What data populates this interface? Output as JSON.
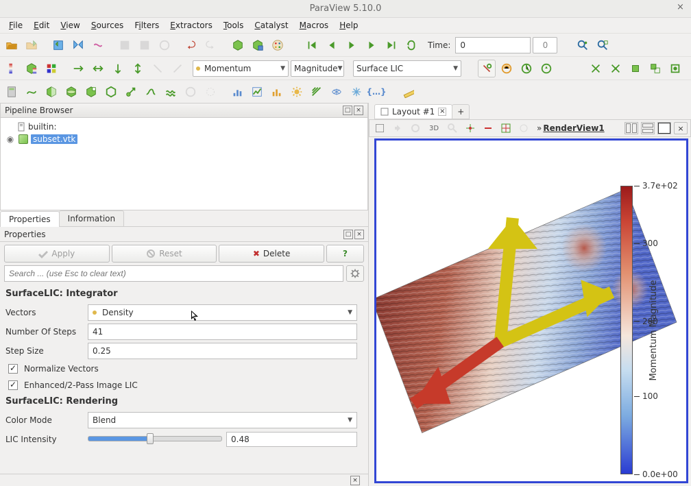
{
  "window": {
    "title": "ParaView 5.10.0",
    "close": "×"
  },
  "menu": [
    "File",
    "Edit",
    "View",
    "Sources",
    "Filters",
    "Extractors",
    "Tools",
    "Catalyst",
    "Macros",
    "Help"
  ],
  "toolbar1": {
    "time_label": "Time:",
    "time_value": "0",
    "frame_value": "0"
  },
  "toolbar2": {
    "combo_array": "Momentum",
    "combo_component": "Magnitude",
    "combo_representation": "Surface LIC"
  },
  "pipeline": {
    "title": "Pipeline Browser",
    "root": "builtin:",
    "item": "subset.vtk"
  },
  "tabs": {
    "properties": "Properties",
    "information": "Information"
  },
  "properties": {
    "head": "Properties",
    "apply": "Apply",
    "reset": "Reset",
    "delete": "Delete",
    "search_placeholder": "Search ... (use Esc to clear text)",
    "section_integrator": "SurfaceLIC: Integrator",
    "vectors_label": "Vectors",
    "vectors_value": "Density",
    "steps_label": "Number Of Steps",
    "steps_value": "41",
    "stepsize_label": "Step Size",
    "stepsize_value": "0.25",
    "normalize": "Normalize Vectors",
    "twopass": "Enhanced/2-Pass Image LIC",
    "section_rendering": "SurfaceLIC: Rendering",
    "colormode_label": "Color Mode",
    "colormode_value": "Blend",
    "licintensity_label": "LIC Intensity",
    "licintensity_value": "0.48"
  },
  "layout": {
    "tab": "Layout #1",
    "renderview": "RenderView1"
  },
  "view_toolbar": {
    "mode3d": "3D"
  },
  "colorbar": {
    "label": "Momentum Magnitude",
    "ticks": [
      {
        "pos": 0,
        "text": "3.7e+02"
      },
      {
        "pos": 20,
        "text": "300"
      },
      {
        "pos": 47,
        "text": "200"
      },
      {
        "pos": 73,
        "text": "100"
      },
      {
        "pos": 100,
        "text": "0.0e+00"
      }
    ]
  }
}
